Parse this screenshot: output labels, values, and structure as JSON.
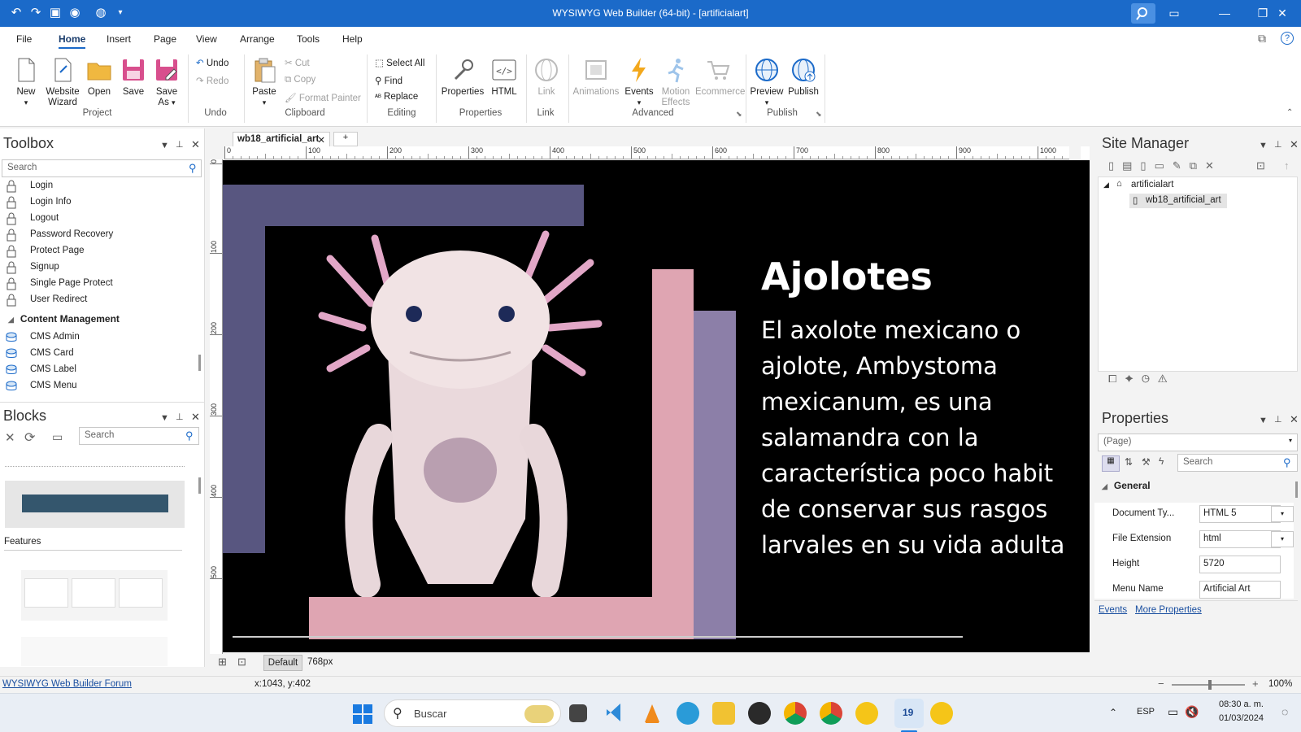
{
  "titlebar": {
    "title": "WYSIWYG Web Builder (64-bit) - [artificialart]"
  },
  "menu": [
    "File",
    "Home",
    "Insert",
    "Page",
    "View",
    "Arrange",
    "Tools",
    "Help"
  ],
  "ribbon": {
    "new": "New",
    "website": "Website",
    "wizard": "Wizard",
    "open": "Open",
    "save": "Save",
    "save_as_1": "Save",
    "save_as_2": "As",
    "undo": "Undo",
    "redo": "Redo",
    "paste": "Paste",
    "cut": "Cut",
    "copy": "Copy",
    "format_painter": "Format Painter",
    "select_all": "Select All",
    "find": "Find",
    "replace": "Replace",
    "properties": "Properties",
    "html": "HTML",
    "link": "Link",
    "animations": "Animations",
    "events": "Events",
    "motion_1": "Motion",
    "motion_2": "Effects",
    "ecommerce": "Ecommerce",
    "preview": "Preview",
    "publish": "Publish",
    "groups": {
      "project": "Project",
      "undo": "Undo",
      "clipboard": "Clipboard",
      "editing": "Editing",
      "properties": "Properties",
      "link": "Link",
      "advanced": "Advanced",
      "publish": "Publish"
    }
  },
  "toolbox": {
    "title": "Toolbox",
    "search_placeholder": "Search",
    "items": [
      "Login",
      "Login Info",
      "Logout",
      "Password Recovery",
      "Protect Page",
      "Signup",
      "Single Page Protect",
      "User Redirect"
    ],
    "section": "Content Management",
    "cms_items": [
      "CMS Admin",
      "CMS Card",
      "CMS Label",
      "CMS Menu"
    ]
  },
  "blocks": {
    "title": "Blocks",
    "search_placeholder": "Search",
    "section": "Features"
  },
  "document": {
    "tab": "wb18_artificial_art",
    "ruler_ticks": [
      "0",
      "100",
      "200",
      "300",
      "400",
      "500",
      "600",
      "700",
      "800",
      "900",
      "1000"
    ],
    "ruler_left_ticks": [
      "0",
      "100",
      "200",
      "300",
      "400",
      "500"
    ],
    "heading": "Ajolotes",
    "body": [
      "El axolote mexicano o",
      "ajolote, Ambystoma",
      "mexicanum, es una",
      "salamandra con la",
      "característica poco habit",
      "de conservar sus rasgos",
      "larvales en su vida adulta"
    ],
    "breakpoint_default": "Default",
    "breakpoint_size": "768px"
  },
  "site_manager": {
    "title": "Site Manager",
    "root": "artificialart",
    "page": "wb18_artificial_art"
  },
  "properties": {
    "title": "Properties",
    "selector": "(Page)",
    "search_placeholder": "Search",
    "section": "General",
    "rows": [
      {
        "key": "Document Ty...",
        "value": "HTML 5"
      },
      {
        "key": "File Extension",
        "value": "html"
      },
      {
        "key": "Height",
        "value": "5720"
      },
      {
        "key": "Menu Name",
        "value": "Artificial Art"
      }
    ],
    "events_link": "Events",
    "more_link": "More Properties"
  },
  "statusbar": {
    "forum": "WYSIWYG Web Builder Forum",
    "coords": "x:1043, y:402",
    "zoom": "100%"
  },
  "taskbar": {
    "search": "Buscar",
    "lang": "ESP",
    "time": "08:30 a. m.",
    "date": "01/03/2024",
    "badge": "19"
  },
  "colors": {
    "accent": "#1b6ac9",
    "slate": "#585680",
    "pink": "#dfa5b2",
    "purple": "#8c7fa8"
  }
}
